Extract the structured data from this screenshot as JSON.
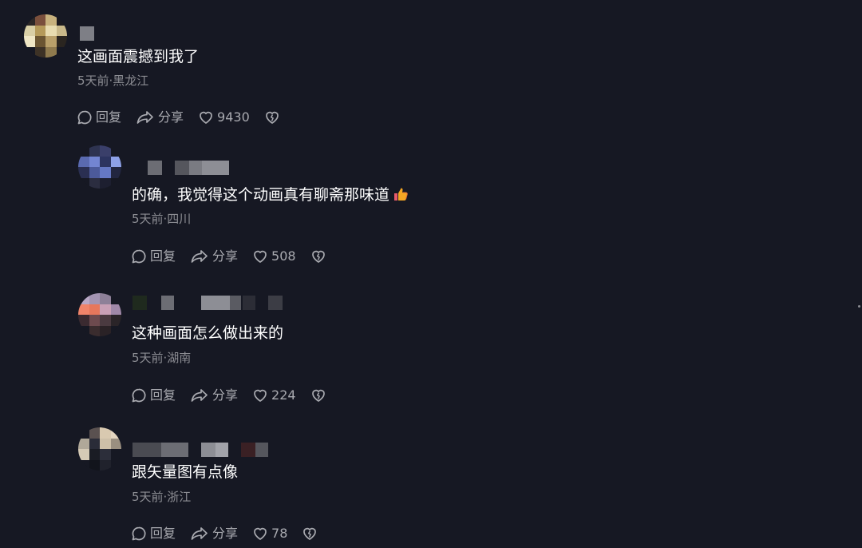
{
  "comments": [
    {
      "text": "这画面震撼到我了",
      "meta": "5天前·黑龙江",
      "reply_label": "回复",
      "share_label": "分享",
      "like_count": "9430"
    },
    {
      "text": "的确，我觉得这个动画真有聊斋那味道",
      "emoji": "thumbs-up-icon",
      "meta": "5天前·四川",
      "reply_label": "回复",
      "share_label": "分享",
      "like_count": "508"
    },
    {
      "text": "这种画面怎么做出来的",
      "meta": "5天前·湖南",
      "reply_label": "回复",
      "share_label": "分享",
      "like_count": "224"
    },
    {
      "text": "跟矢量图有点像",
      "meta": "5天前·浙江",
      "reply_label": "回复",
      "share_label": "分享",
      "like_count": "78"
    }
  ],
  "icons": {
    "reply": "comment-bubble-icon",
    "share": "share-arrow-icon",
    "like": "heart-icon",
    "dislike": "broken-heart-icon"
  },
  "colors": {
    "background": "#161823",
    "text": "#ffffff",
    "meta": "#8c8d93",
    "actions": "#a9aab0"
  }
}
